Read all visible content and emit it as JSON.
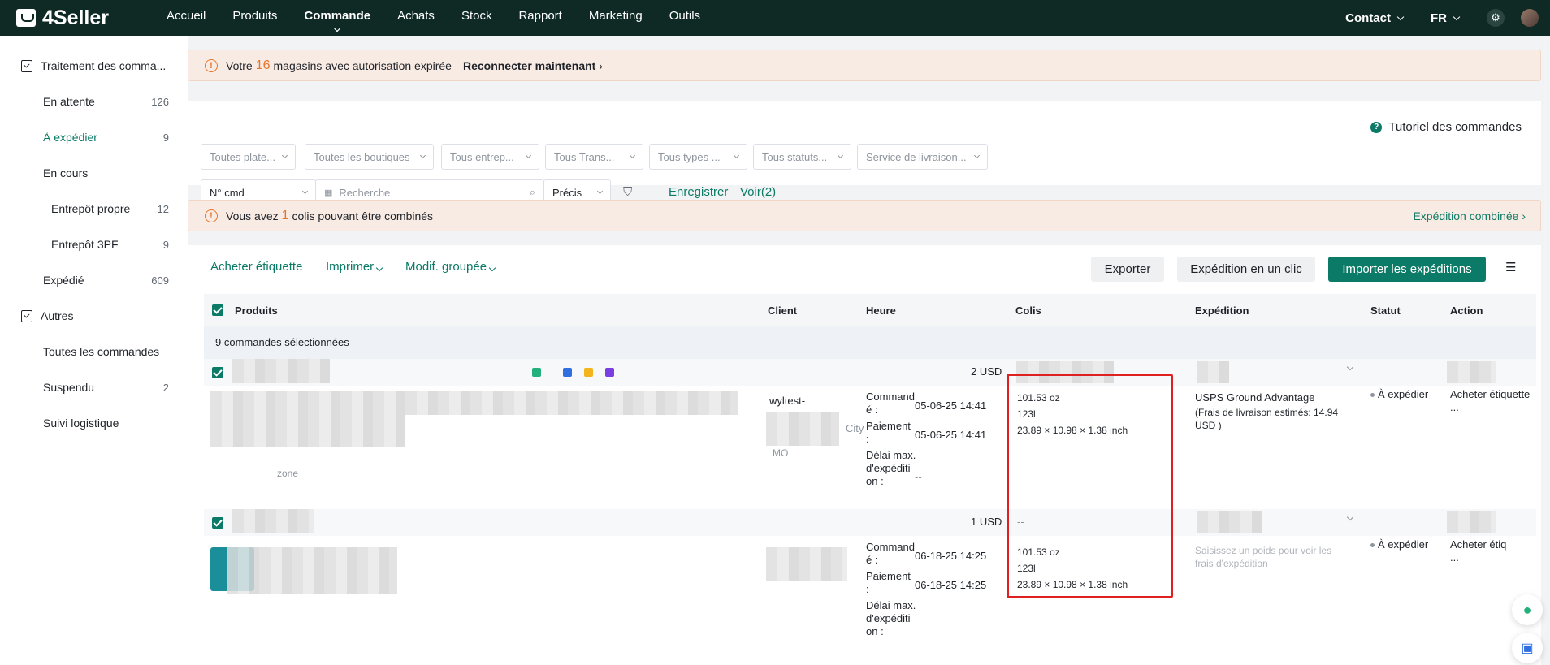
{
  "brand": "4Seller",
  "nav": [
    "Accueil",
    "Produits",
    "Commande",
    "Achats",
    "Stock",
    "Rapport",
    "Marketing",
    "Outils"
  ],
  "top_right": {
    "contact": "Contact",
    "lang": "FR"
  },
  "sidebar": {
    "group1": "Traitement des comma...",
    "items1": [
      {
        "label": "En attente",
        "count": "126"
      },
      {
        "label": "À expédier",
        "count": "9"
      },
      {
        "label": "En cours",
        "count": ""
      },
      {
        "label": "Entrepôt propre",
        "count": "12"
      },
      {
        "label": "Entrepôt 3PF",
        "count": "9"
      },
      {
        "label": "Expédié",
        "count": "609"
      }
    ],
    "group2": "Autres",
    "items2": [
      {
        "label": "Toutes les commandes",
        "count": ""
      },
      {
        "label": "Suspendu",
        "count": "2"
      },
      {
        "label": "Suivi logistique",
        "count": ""
      }
    ]
  },
  "banner1": {
    "pre": "Votre",
    "num": "16",
    "post": "magasins avec autorisation expirée",
    "action": "Reconnecter maintenant"
  },
  "filters": {
    "selects": [
      "Toutes plate...",
      "Toutes les boutiques",
      "Tous entrep...",
      "Tous Trans...",
      "Tous types ...",
      "Tous statuts...",
      "Service de livraison..."
    ],
    "order_field": "N° cmd",
    "search_placeholder": "Recherche",
    "match": "Précis",
    "save": "Enregistrer",
    "view": "Voir(2)",
    "tutorial": "Tutoriel des commandes"
  },
  "banner2": {
    "pre": "Vous avez",
    "num": "1",
    "post": "colis pouvant être combinés",
    "action": "Expédition combinée"
  },
  "toolbar": {
    "buy_label": "Acheter étiquette",
    "print": "Imprimer",
    "bulk": "Modif. groupée",
    "export": "Exporter",
    "one_click": "Expédition en un clic",
    "import": "Importer les expéditions"
  },
  "columns": [
    "Produits",
    "Client",
    "Heure",
    "Colis",
    "Expédition",
    "Statut",
    "Action"
  ],
  "selected_text": "9 commandes sélectionnées",
  "orders": [
    {
      "group_amount": "2 USD",
      "client_name": "wyltest-",
      "client_city": "City",
      "client_code": "MO",
      "product_note": "zone",
      "time_labels": [
        "Command\né :",
        "Paiement\n:",
        "Délai max.\nd'expéditi\non :"
      ],
      "times": [
        "05-06-25 14:41",
        "05-06-25 14:41",
        "--"
      ],
      "parcel": [
        "101.53 oz",
        "123l",
        "23.89 × 10.98 × 1.38 inch"
      ],
      "shipping": "USPS Ground Advantage",
      "shipping_fee": "(Frais de livraison estimés:  14.94 USD )",
      "status": "À expédier",
      "action": "Acheter étiquette",
      "more": "..."
    },
    {
      "group_amount": "1 USD",
      "group_parcel": "--",
      "time_labels": [
        "Command\né :",
        "Paiement\n:",
        "Délai max.\nd'expéditi\non :"
      ],
      "times": [
        "06-18-25 14:25",
        "06-18-25 14:25",
        "--"
      ],
      "parcel": [
        "101.53 oz",
        "123l",
        "23.89 × 10.98 × 1.38 inch"
      ],
      "shipping_hint": "Saisissez un poids pour voir les frais d'expédition",
      "status": "À expédier",
      "action": "Acheter étiq",
      "more": "..."
    }
  ]
}
